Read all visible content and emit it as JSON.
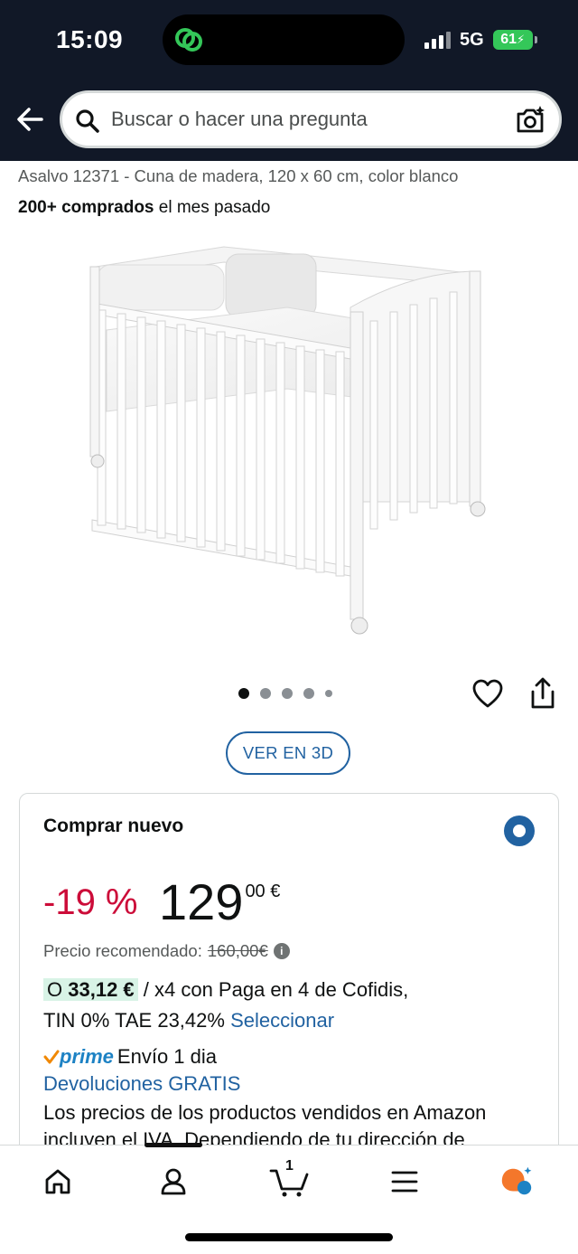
{
  "status_bar": {
    "time": "15:09",
    "network": "5G",
    "battery": "61"
  },
  "header": {
    "search_placeholder": "Buscar o hacer una pregunta",
    "icons": [
      "back-arrow-icon",
      "search-icon",
      "camera-search-icon"
    ]
  },
  "product": {
    "title": "Asalvo 12371 - Cuna de madera, 120 x 60 cm, color blanco",
    "bought_bold": "200+ comprados",
    "bought_rest": " el mes pasado",
    "image_count": 5,
    "active_image": 1,
    "view_3d_label": "VER EN 3D"
  },
  "buy_box": {
    "title": "Comprar nuevo",
    "discount": "-19 %",
    "price_whole": "129",
    "price_fraction": "00 €",
    "rrp_label": "Precio recomendado:",
    "rrp_value": "160,00€",
    "installment_prefix": "O",
    "installment_amount": "33,12 €",
    "installment_text": " / x4 con Paga en 4 de Cofidis,",
    "installment_terms": "TIN 0% TAE 23,42%",
    "installment_link": "Seleccionar",
    "prime_label": "prime",
    "delivery": "Envío 1 dia",
    "returns_link": "Devoluciones GRATIS",
    "legal_text": "Los precios de los productos vendidos en Amazon incluyen el IVA. Dependiendo de tu dirección de"
  },
  "bottom_nav": {
    "cart_count": "1",
    "items": [
      "home-icon",
      "account-icon",
      "cart-icon",
      "menu-icon",
      "rufus-icon"
    ]
  },
  "colors": {
    "header_bg": "#111827",
    "link": "#2162a1",
    "discount": "#cc0c39",
    "prime": "#1d82c4",
    "installment_highlight": "#d8f3e6"
  }
}
